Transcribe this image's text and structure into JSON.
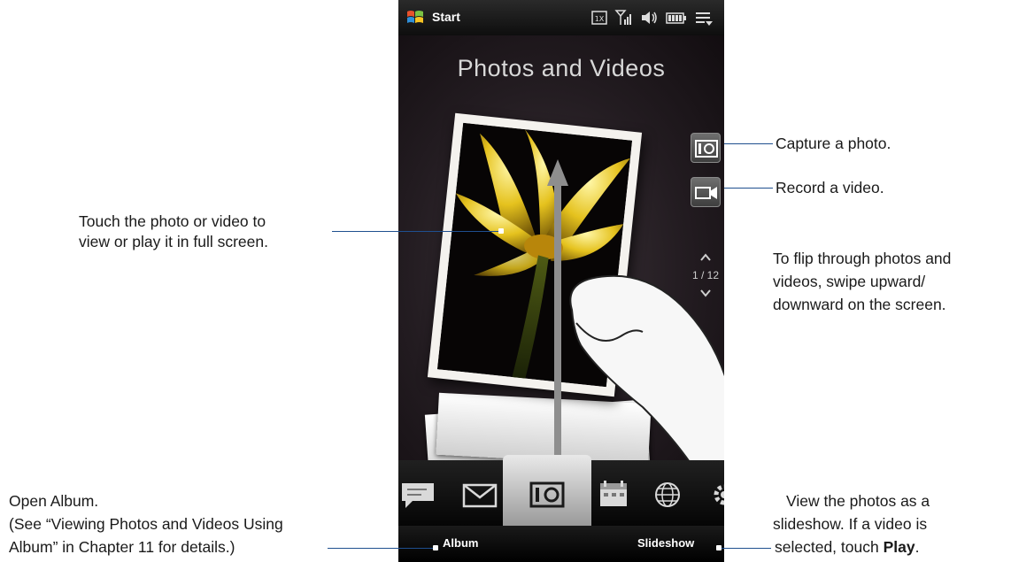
{
  "status_bar": {
    "start_label": "Start",
    "icons": [
      "windows-start-icon",
      "network-1x-icon",
      "signal-strength-icon",
      "volume-icon",
      "battery-icon",
      "menu-icon"
    ]
  },
  "app": {
    "title": "Photos and Videos",
    "pager": {
      "count": "1 / 12",
      "current": 1,
      "total": 12
    }
  },
  "tabs": [
    {
      "name": "messages-icon",
      "active": false
    },
    {
      "name": "mail-icon",
      "active": false
    },
    {
      "name": "camera-icon",
      "active": true
    },
    {
      "name": "calendar-icon",
      "active": false
    },
    {
      "name": "internet-icon",
      "active": false
    },
    {
      "name": "settings-icon",
      "active": false
    }
  ],
  "softkeys": {
    "left": "Album",
    "right": "Slideshow"
  },
  "callouts": {
    "capture_photo": "Capture a photo.",
    "record_video": "Record a video.",
    "touch_photo_line1": "Touch the photo or video to",
    "touch_photo_line2": "view or play it in full screen.",
    "flip_line1": "To flip through photos and",
    "flip_line2": "videos, swipe upward/",
    "flip_line3": "downward on the screen.",
    "album_line1": "Open Album.",
    "album_line2": "(See “Viewing Photos and Videos Using",
    "album_line3": "Album” in Chapter 11 for details.)",
    "slideshow_line1": "View the photos as a",
    "slideshow_line2": "slideshow. If a video is",
    "slideshow_line3_prefix": "selected, touch ",
    "slideshow_line3_bold": "Play",
    "slideshow_line3_suffix": "."
  },
  "colors": {
    "callout_line": "#1f4f8f",
    "tab_active": "#d9d9d9"
  }
}
